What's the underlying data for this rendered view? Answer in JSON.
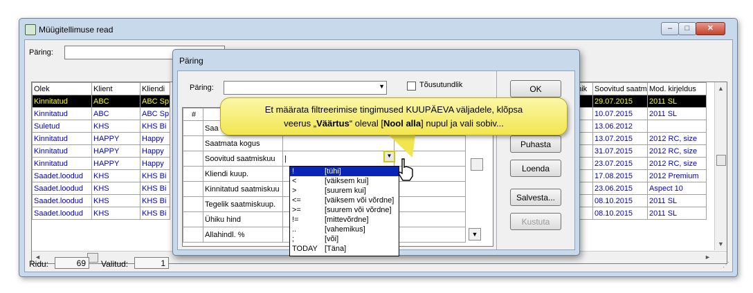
{
  "window": {
    "title": "Müügitellimuse read",
    "minimize": "–",
    "maximize": "□",
    "close": "✕"
  },
  "query": {
    "label": "Päring:"
  },
  "grid": {
    "columns": [
      "Olek",
      "Klient",
      "Kliendi"
    ],
    "rows": [
      [
        "Kinnitatud",
        "ABC",
        "ABC Sp"
      ],
      [
        "Kinnitatud",
        "ABC",
        "ABC Sp"
      ],
      [
        "Suletud",
        "KHS",
        "KHS Bi"
      ],
      [
        "Kinnitatud",
        "HAPPY",
        "Happy"
      ],
      [
        "Kinnitatud",
        "HAPPY",
        "Happy"
      ],
      [
        "Kinnitatud",
        "HAPPY",
        "Happy"
      ],
      [
        "Saadet.loodud",
        "KHS",
        "KHS Bi"
      ],
      [
        "Saadet.loodud",
        "KHS",
        "KHS Bi"
      ],
      [
        "Saadet.loodud",
        "KHS",
        "KHS Bi"
      ],
      [
        "Saadet.loodud",
        "KHS",
        "KHS Bi"
      ]
    ],
    "right_columns": [
      "ühik",
      "Soovitud saatm",
      "Mod. kirjeldus"
    ],
    "right_rows": [
      [
        "",
        "29.07.2015",
        "2011 SL"
      ],
      [
        "",
        "10.07.2015",
        "2011 SL"
      ],
      [
        "",
        "13.06.2012",
        ""
      ],
      [
        "",
        "13.07.2015",
        "2012 RC, size"
      ],
      [
        "",
        "31.07.2015",
        "2012 RC, size"
      ],
      [
        "",
        "23.07.2015",
        "2012 RC, size"
      ],
      [
        "",
        "17.08.2015",
        "2012 Premium"
      ],
      [
        "",
        "23.06.2015",
        "Aspect 10"
      ],
      [
        "",
        "08.10.2015",
        "2011 SL"
      ],
      [
        "",
        "08.10.2015",
        "2011 SL"
      ]
    ]
  },
  "status": {
    "rows_label": "Ridu:",
    "rows_value": "69",
    "selected_label": "Valitud:",
    "selected_value": "1"
  },
  "dialog": {
    "title": "Päring",
    "query_label": "Päring:",
    "checkbox_label": "Tõusutundlik",
    "buttons": {
      "ok": "OK",
      "clear": "Puhasta",
      "read": "Loenda",
      "save": "Salvesta...",
      "delete": "Kustuta"
    },
    "grid_header": "#",
    "fields": [
      "Saa",
      "Saatmata kogus",
      "Soovitud saatmiskuu",
      "Kliendi kuup.",
      "Kinnitatud saatmiskuu",
      "Tegelik saatmiskuup.",
      "Ühiku hind",
      "Allahindl. %"
    ],
    "active_value": "|"
  },
  "dropdown": {
    "items": [
      {
        "sym": "!",
        "desc": "[tühi]"
      },
      {
        "sym": "<",
        "desc": "[väiksem kui]"
      },
      {
        "sym": ">",
        "desc": "[suurem kui]"
      },
      {
        "sym": "<=",
        "desc": "[väiksem või võrdne]"
      },
      {
        "sym": ">=",
        "desc": "[suurem või võrdne]"
      },
      {
        "sym": "!=",
        "desc": "[mittevõrdne]"
      },
      {
        "sym": "..",
        "desc": "[vahemikus]"
      },
      {
        "sym": ";",
        "desc": "[või]"
      },
      {
        "sym": "TODAY",
        "desc": "[Täna]"
      }
    ]
  },
  "callout": {
    "line1": "Et määrata filtreerimise tingimused KUUPÄEVA väljadele, klõpsa",
    "line2_pre": "veerus „",
    "line2_bold1": "Väärtus",
    "line2_mid1": "“ oleval [",
    "line2_bold2": "Nool alla",
    "line2_post": "] nupul ja vali sobiv..."
  },
  "colors": {
    "selected_row_bg": "#000000",
    "selected_row_text": "#ffff00",
    "link_text": "#0000cc",
    "callout_fill": "#f2e64f",
    "list_highlight": "#0a24b8"
  }
}
